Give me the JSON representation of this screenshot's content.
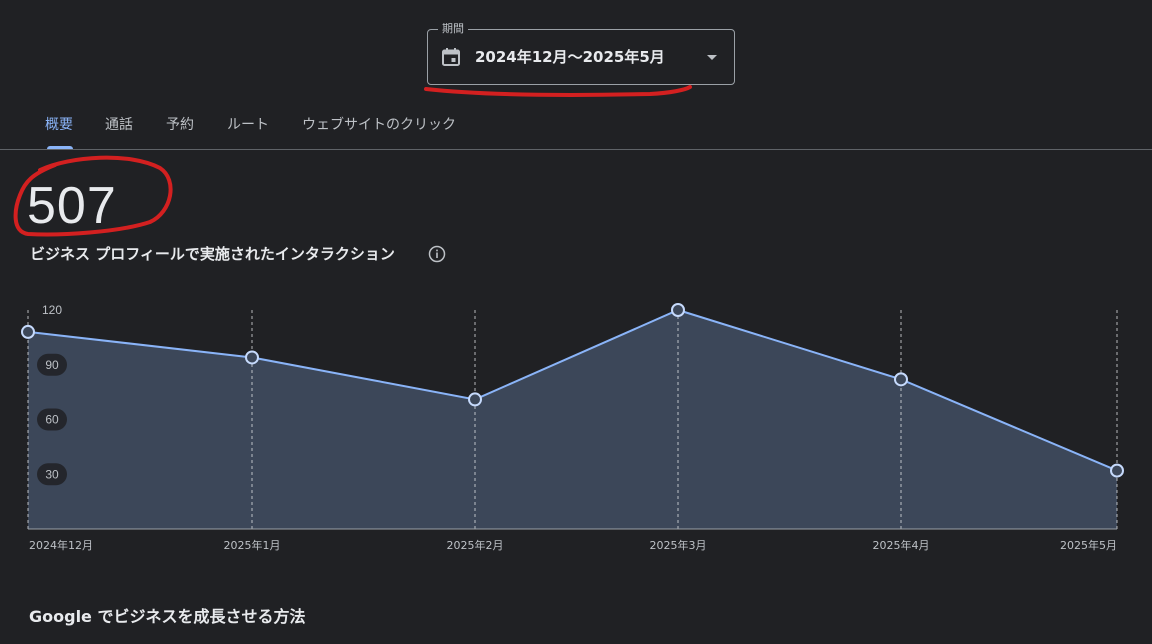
{
  "period": {
    "legend": "期間",
    "value": "2024年12月〜2025年5月",
    "icon": "calendar-icon"
  },
  "tabs": [
    {
      "label": "概要",
      "active": true
    },
    {
      "label": "通話",
      "active": false
    },
    {
      "label": "予約",
      "active": false
    },
    {
      "label": "ルート",
      "active": false
    },
    {
      "label": "ウェブサイトのクリック",
      "active": false
    }
  ],
  "metric": {
    "value": "507",
    "label": "ビジネス プロフィールで実施されたインタラクション",
    "info_icon": "info-icon"
  },
  "chart_data": {
    "type": "area",
    "categories": [
      "2024年12月",
      "2025年1月",
      "2025年2月",
      "2025年3月",
      "2025年4月",
      "2025年5月"
    ],
    "values": [
      108,
      94,
      71,
      120,
      82,
      32
    ],
    "ylim": [
      0,
      120
    ],
    "yticks": [
      120,
      90,
      60,
      30
    ],
    "line_color": "#8ab4f8",
    "fill_color": "#3c4759",
    "grid": "vertical dashed at each category"
  },
  "footer": {
    "heading": "Google でビジネスを成長させる方法"
  },
  "colors": {
    "background": "#202124",
    "accent": "#8ab4f8",
    "annotation": "#d32020"
  }
}
